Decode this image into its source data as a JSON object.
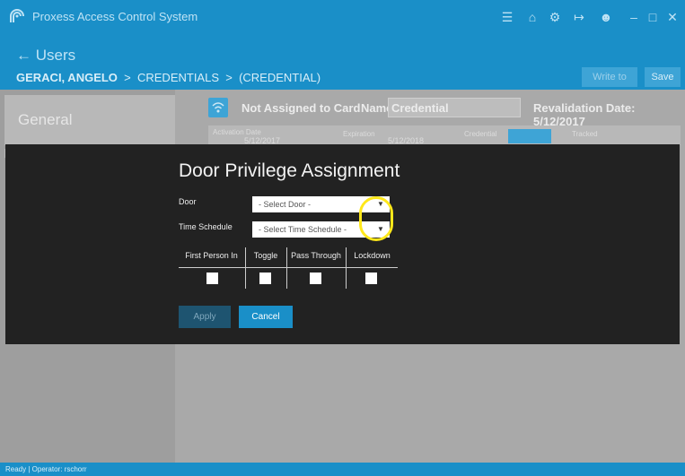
{
  "window": {
    "title": "Proxess Access Control System",
    "controls": [
      "menu-icon",
      "home-icon",
      "gear-icon",
      "logout-icon",
      "user-icon",
      "minimize-icon",
      "maximize-icon",
      "close-icon"
    ]
  },
  "header": {
    "back_label": "← Users",
    "breadcrumb": {
      "user": "GERACI, ANGELO",
      "sep1": ">",
      "section": "CREDENTIALS",
      "sep2": ">",
      "page": "(CREDENTIAL)"
    },
    "write_to_card": "Write to Card",
    "save": "Save"
  },
  "sidebar": {
    "items": [
      {
        "label": "General"
      }
    ]
  },
  "credential": {
    "status": "Not Assigned to Card",
    "name_label": "Name:",
    "name_value": "Credential",
    "revalidation": "Revalidation Date:  5/12/2017",
    "activation_label": "Activation Date",
    "activation_value": "5/12/2017",
    "expiration_label": "Expiration",
    "expiration_value": "5/12/2018",
    "credential_label": "Credential",
    "tracked_label": "Tracked"
  },
  "dialog": {
    "title": "Door Privilege Assignment",
    "door_label": "Door",
    "door_placeholder": "- Select Door -",
    "schedule_label": "Time Schedule",
    "schedule_placeholder": "- Select Time Schedule -",
    "columns": [
      "First Person In",
      "Toggle",
      "Pass Through",
      "Lockdown"
    ],
    "apply": "Apply",
    "cancel": "Cancel"
  },
  "status_bar": {
    "text": "Ready  |  Operator: rschorr"
  },
  "colors": {
    "accent": "#1a8fc8",
    "dialog_bg": "#222222",
    "highlight": "#ffe81a"
  }
}
